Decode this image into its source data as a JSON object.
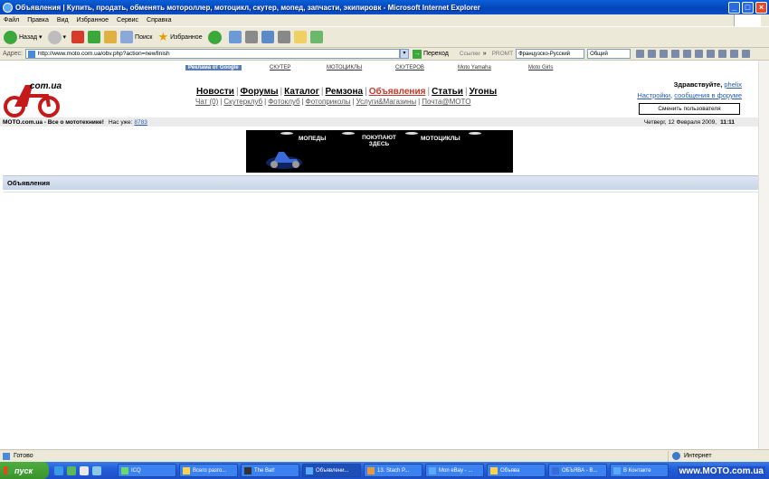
{
  "window": {
    "title": "Объявления | Купить, продать, обменять мотороллер, мотоцикл, скутер, мопед, запчасти, экипировк - Microsoft Internet Explorer",
    "minimize": "_",
    "maximize": "□",
    "close": "×"
  },
  "menu": [
    "Файл",
    "Правка",
    "Вид",
    "Избранное",
    "Сервис",
    "Справка"
  ],
  "toolbar": {
    "back": "Назад",
    "search": "Поиск",
    "favorites": "Избранное"
  },
  "addressbar": {
    "label": "Адрес:",
    "url": "http://www.moto.com.ua/obv.php?action=newfinish",
    "go": "Переход",
    "links": "Ссылки",
    "promt": "PROMT",
    "translate_dir": "Французско-Русский",
    "dict": "Общий"
  },
  "site": {
    "logo_text": "com.ua",
    "ad_label": "Реклама от Google",
    "top_links": [
      {
        "label": "СКУТЕР"
      },
      {
        "label": "МОТОЦИКЛЫ"
      },
      {
        "label": "СКУТЕРОВ"
      },
      {
        "label": "Moto Yamaha"
      },
      {
        "label": "Moto Girls"
      }
    ],
    "mainnav": [
      {
        "label": "Новости",
        "active": false
      },
      {
        "label": "Форумы",
        "active": false
      },
      {
        "label": "Каталог",
        "active": false
      },
      {
        "label": "Ремзона",
        "active": false
      },
      {
        "label": "Объявления",
        "active": true
      },
      {
        "label": "Статьи",
        "active": false
      },
      {
        "label": "Угоны",
        "active": false
      }
    ],
    "subnav": [
      "Чат (0)",
      "Скутерклуб",
      "Фотоклуб",
      "Фотоприколы",
      "Услуги&Магазины",
      "Почта@MOTO"
    ],
    "greeting": "Здравствуйте,",
    "username": "phelix",
    "settings_link": "Настройки",
    "forum_messages_link": "сообщения в форуме",
    "switch_user": "Сменить пользователя",
    "status_site": "MOTO.com.ua - Все о мототехнике!",
    "online_label": "Нас уже:",
    "online_count": "8783",
    "date": "Четверг, 12 Февраля 2009,",
    "time": "11:11",
    "banner": {
      "left": "МОПЕДЫ",
      "middle": "ПОКУПАЮТ ЗДЕСЬ",
      "right": "МОТОЦИКЛЫ"
    },
    "section_title": "Объявления"
  },
  "statusbar": {
    "status": "Готово",
    "zone": "Интернет"
  },
  "taskbar": {
    "start": "пуск",
    "tasks": [
      {
        "label": "ICQ",
        "active": false
      },
      {
        "label": "Всего разго...",
        "active": false
      },
      {
        "label": "The Bat!",
        "active": false
      },
      {
        "label": "Объявлени...",
        "active": true
      },
      {
        "label": "13. Stach P...",
        "active": false
      },
      {
        "label": "Mon eBay - ...",
        "active": false
      },
      {
        "label": "Объява",
        "active": false
      },
      {
        "label": "ОБЪЯВА - В...",
        "active": false
      },
      {
        "label": "В Контакте",
        "active": false
      }
    ],
    "watermark": "www.MOTO.com.ua"
  }
}
